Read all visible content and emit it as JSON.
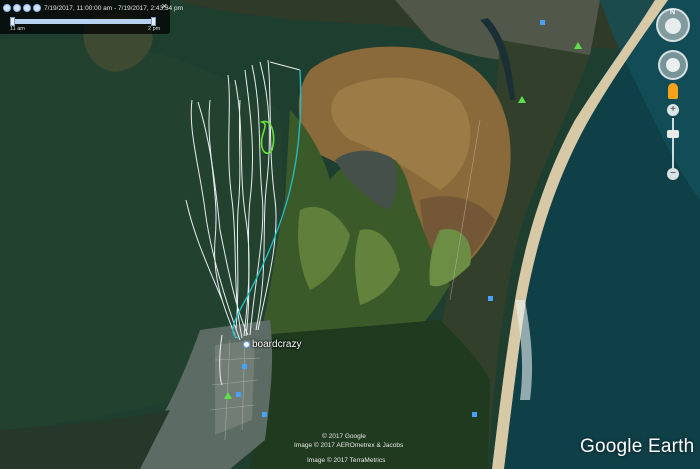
{
  "timeline": {
    "range_text": "7/19/2017, 11:00:00 am - 7/19/2017, 2:43:34 pm",
    "start_label": "11 am",
    "end_label": "2 pm",
    "icons": [
      "clock-icon",
      "zoom-in-icon",
      "zoom-out-icon",
      "settings-icon"
    ],
    "close_icon": "close-icon"
  },
  "place": {
    "label": "boardcrazy"
  },
  "navigation": {
    "north_label": "N",
    "zoom_in": "+",
    "zoom_out": "−",
    "icons": [
      "compass-icon",
      "look-icon",
      "pan-icon",
      "pegman-icon"
    ]
  },
  "attribution": {
    "line1": "© 2017 Google",
    "line2": "Image © 2017 AEROmetrex & Jacobs",
    "line3": "Image © 2017 TerraMetrics"
  },
  "brand": {
    "name": "Google Earth"
  },
  "colors": {
    "water": "#1e3e2f",
    "lagoon": "#8a6a3a",
    "forest": "#1f3a1e",
    "ocean": "#0f3f47",
    "beach": "#d8c9a6",
    "track_white": "#e9eef0",
    "track_cyan": "#26b8c2",
    "track_green": "#69e23a"
  }
}
